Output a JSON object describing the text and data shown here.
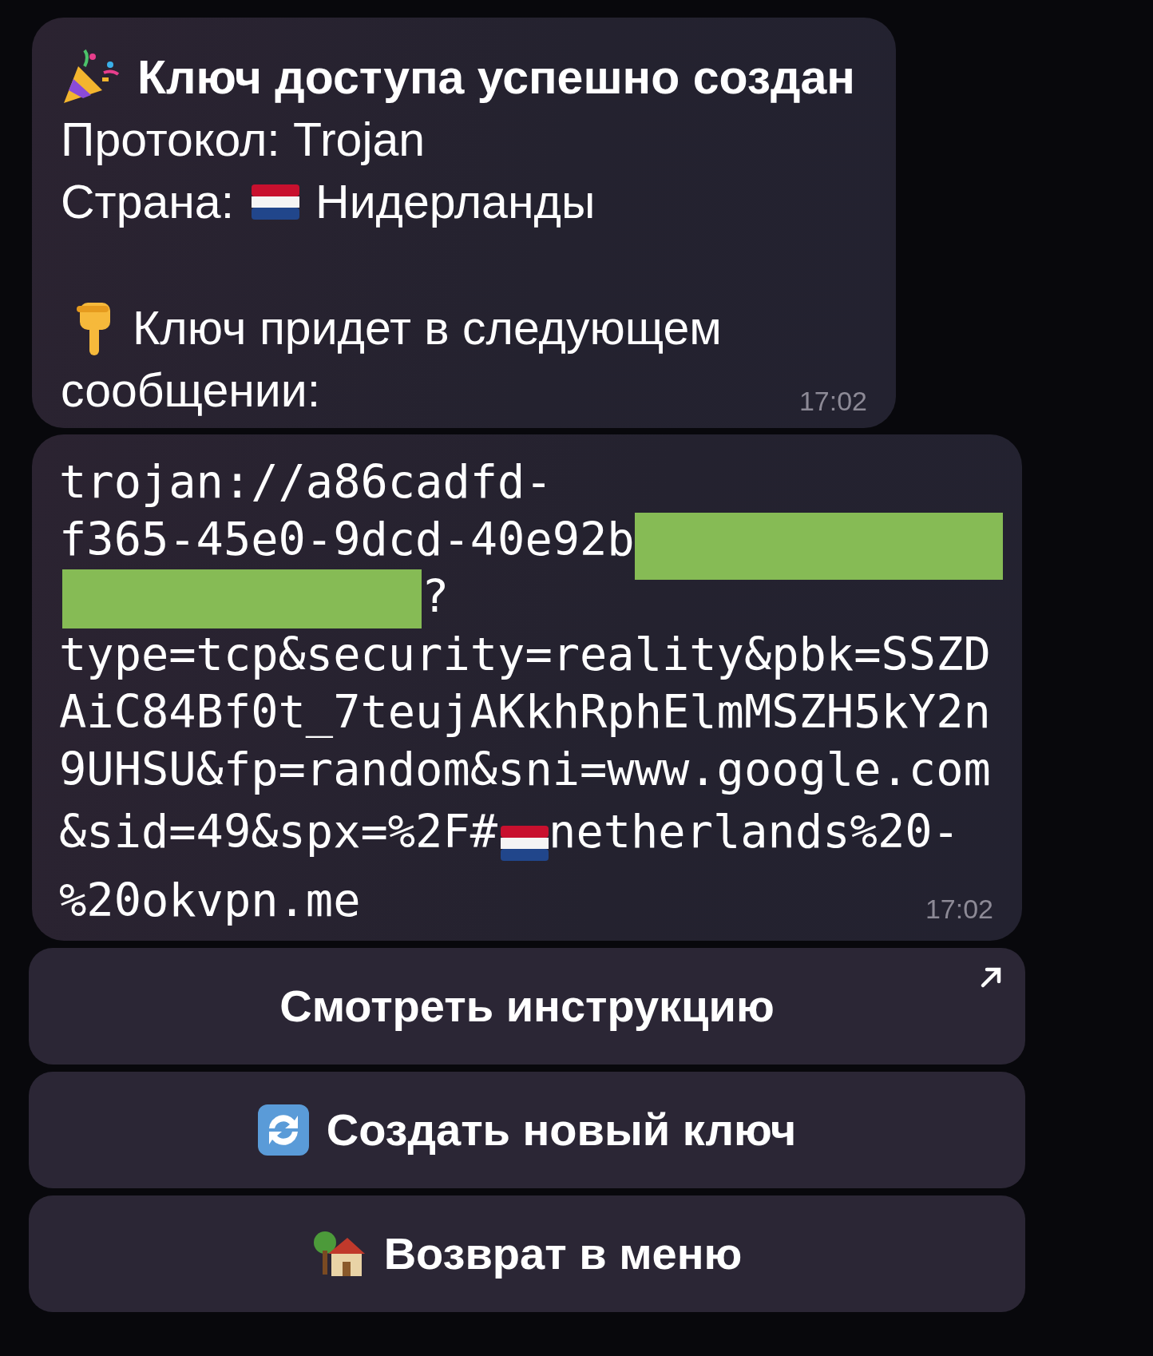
{
  "messages": [
    {
      "kind": "text",
      "time": "17:02",
      "paragraphs": [
        [
          [
            {
              "kind": "popper"
            },
            {
              "kind": "bold",
              "text": "Ключ доступа успешно создан"
            }
          ],
          [
            {
              "kind": "text",
              "text": "Протокол: Trojan"
            }
          ],
          [
            {
              "kind": "text",
              "text": "Страна:"
            },
            {
              "kind": "flag"
            },
            {
              "kind": "text",
              "text": "Нидерланды"
            }
          ]
        ],
        [
          [
            {
              "kind": "hand"
            },
            {
              "kind": "text",
              "text": "Ключ придет в следующем"
            }
          ],
          [
            {
              "kind": "text",
              "text": "сообщении:"
            }
          ]
        ]
      ]
    },
    {
      "kind": "code",
      "time": "17:02",
      "paragraphs": [
        [
          [
            {
              "kind": "text",
              "text": "trojan://a86cadfd-"
            }
          ],
          [
            {
              "kind": "text",
              "text": "f365-45e0-9dcd-40e92b"
            },
            {
              "kind": "redaction"
            }
          ],
          [
            {
              "kind": "redaction"
            },
            {
              "kind": "text",
              "text": "?"
            }
          ],
          [
            {
              "kind": "text",
              "text": "type=tcp&security=reality&pbk=SSZD"
            }
          ],
          [
            {
              "kind": "text",
              "text": "AiC84Bf0t_7teujAKkhRphElmMSZH5kY2n"
            }
          ],
          [
            {
              "kind": "text",
              "text": "9UHSU&fp=random&sni=www.google.com"
            }
          ],
          [
            {
              "kind": "text",
              "text": "&sid=49&spx=%2F#"
            },
            {
              "kind": "flag"
            },
            {
              "kind": "text",
              "text": "netherlands%20-"
            }
          ],
          [
            {
              "kind": "text",
              "text": "%20okvpn.me"
            }
          ]
        ]
      ]
    }
  ],
  "buttons": [
    {
      "label": "Смотреть инструкцию",
      "kind": "url"
    },
    {
      "label": "Создать новый ключ",
      "kind": "refresh"
    },
    {
      "label": "Возврат в меню",
      "kind": "house"
    }
  ]
}
